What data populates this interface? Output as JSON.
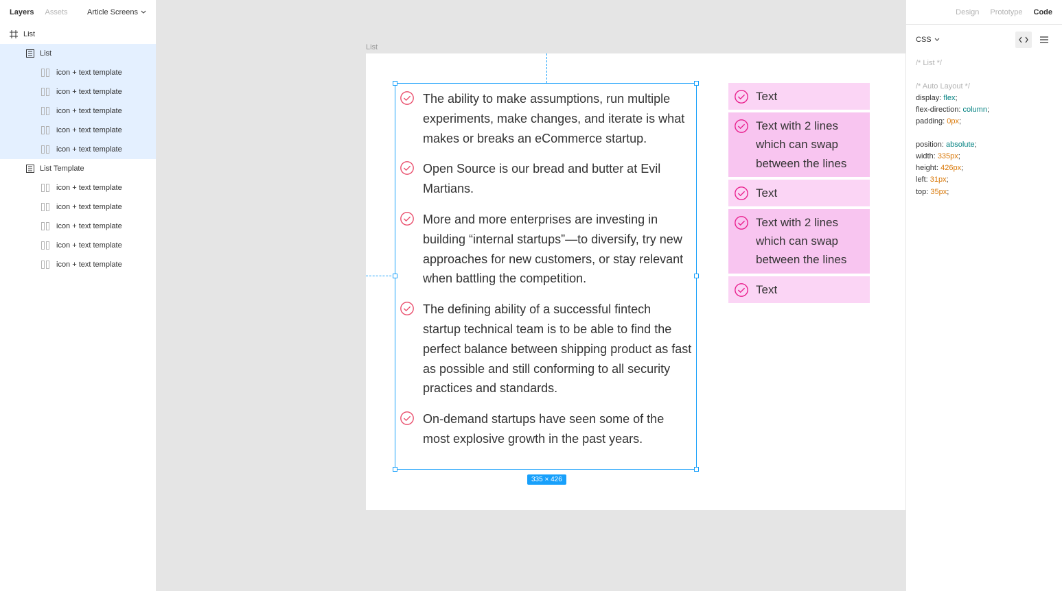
{
  "leftPanel": {
    "tabs": {
      "layers": "Layers",
      "assets": "Assets"
    },
    "pageName": "Article Screens",
    "rootLayer": "List",
    "tree": [
      {
        "label": "List",
        "type": "frame",
        "selected": true,
        "children": [
          {
            "label": "icon + text template"
          },
          {
            "label": "icon + text template"
          },
          {
            "label": "icon + text template"
          },
          {
            "label": "icon + text template"
          },
          {
            "label": "icon + text template"
          }
        ]
      },
      {
        "label": "List Template",
        "type": "frame",
        "selected": false,
        "children": [
          {
            "label": "icon + text template"
          },
          {
            "label": "icon + text template"
          },
          {
            "label": "icon + text template"
          },
          {
            "label": "icon + text template"
          },
          {
            "label": "icon + text template"
          }
        ]
      }
    ]
  },
  "canvas": {
    "frameLabel": "List",
    "sizeBadge": "335 × 426",
    "listItems": [
      "The ability to make assumptions, run multiple experiments, make changes, and iterate is what makes or breaks an eCommerce startup.",
      "Open Source is our bread and butter at Evil Martians.",
      "More and more enterprises are investing in building “internal startups”—to diversify, try new approaches for new customers, or stay relevant when battling the competition.",
      "The defining ability of a successful fintech startup technical team is to be able to find the perfect balance between shipping product as fast as possible and still conforming to all security practices and standards.",
      "On-demand startups have seen some of the most explosive growth in the past years."
    ],
    "templateItems": [
      "Text",
      "Text with 2 lines which can swap between the lines",
      "Text",
      "Text with 2 lines which can swap between the lines",
      "Text"
    ]
  },
  "rightPanel": {
    "tabs": {
      "design": "Design",
      "prototype": "Prototype",
      "code": "Code"
    },
    "language": "CSS",
    "code": {
      "c1": "/* List */",
      "c2": "/* Auto Layout */",
      "l1a": "display:",
      "l1b": "flex",
      "l2a": "flex-direction:",
      "l2b": "column",
      "l3a": "padding:",
      "l3b": "0px",
      "l4a": "position:",
      "l4b": "absolute",
      "l5a": "width:",
      "l5b": "335px",
      "l6a": "height:",
      "l6b": "426px",
      "l7a": "left:",
      "l7b": "31px",
      "l8a": "top:",
      "l8b": "35px"
    }
  }
}
